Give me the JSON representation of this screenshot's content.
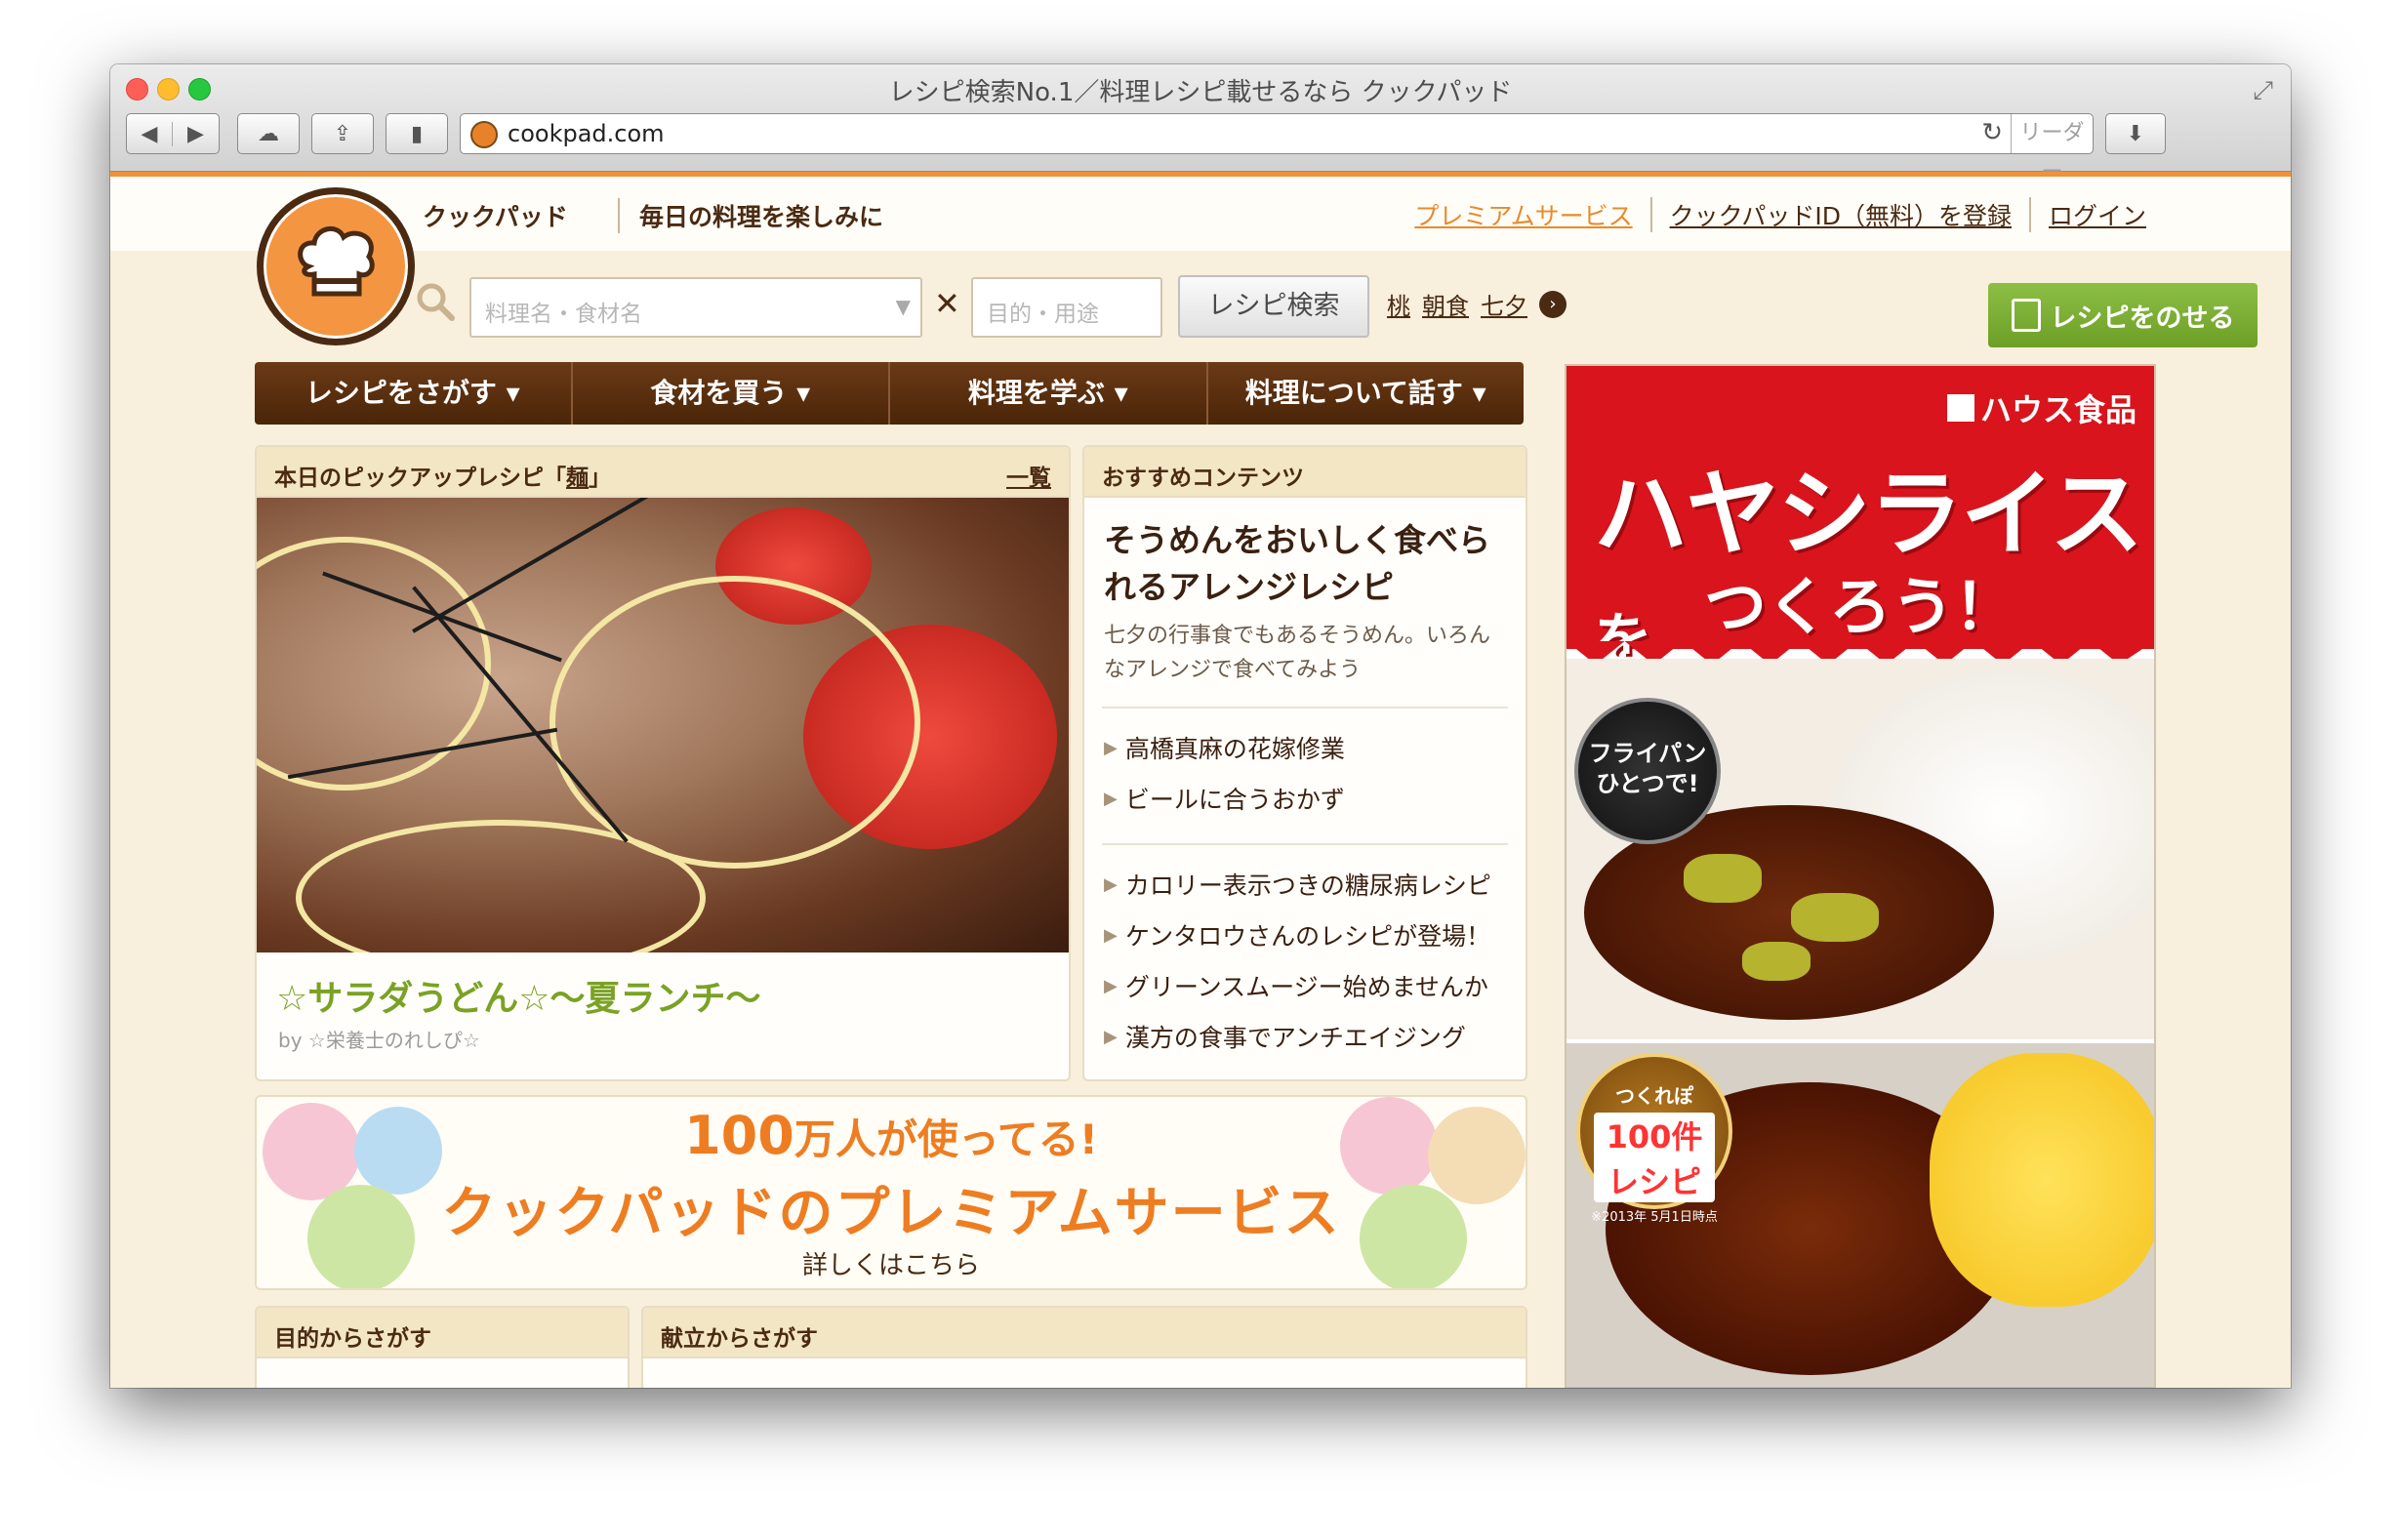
{
  "window": {
    "title": "レシピ検索No.1／料理レシピ載せるなら クックパッド",
    "url": "cookpad.com",
    "reader_label": "リーダー"
  },
  "header": {
    "site_name": "クックパッド",
    "tagline": "毎日の料理を楽しみに",
    "links": [
      "プレミアムサービス",
      "クックパッドID（無料）を登録",
      "ログイン"
    ],
    "search_placeholder": "料理名・食材名",
    "purpose_placeholder": "目的・用途",
    "search_button": "レシピ検索",
    "keywords": [
      "桃",
      "朝食",
      "七夕"
    ],
    "post_recipe": "レシピをのせる"
  },
  "nav": {
    "items": [
      "レシピをさがす ▾",
      "食材を買う ▾",
      "料理を学ぶ ▾",
      "料理について話す ▾"
    ]
  },
  "pickup": {
    "heading_prefix": "本日のピックアップレシピ「",
    "heading_keyword": "麺",
    "heading_suffix": "」",
    "list_link": "一覧",
    "recipe_title": "☆サラダうどん☆〜夏ランチ〜",
    "author": "by ☆栄養士のれしぴ☆"
  },
  "recommend": {
    "heading": "おすすめコンテンツ",
    "feature_title": "そうめんをおいしく食べられるアレンジレシピ",
    "feature_desc": "七夕の行事食でもあるそうめん。いろんなアレンジで食べてみよう",
    "links_a": [
      "高橋真麻の花嫁修業",
      "ビールに合うおかず"
    ],
    "links_b": [
      "カロリー表示つきの糖尿病レシピ",
      "ケンタロウさんのレシピが登場！",
      "グリーンスムージー始めませんか",
      "漢方の食事でアンチエイジング"
    ]
  },
  "premium_banner": {
    "number": "100",
    "users": "万人が使ってる!",
    "main": "クックパッドのプレミアムサービス",
    "detail": "詳しくはこちら"
  },
  "bottom": {
    "purpose_heading": "目的からさがす",
    "menu_heading": "献立からさがす"
  },
  "ad": {
    "brand": "ハウス食品",
    "headline": "ハヤシライス",
    "headline_particle": "を",
    "sub": "つくろう！",
    "pan_badge": "フライパン ひとつで!",
    "badge2_l1": "つくれぽ",
    "badge2_l2": "100件レシピ",
    "badge2_l3": "※2013年 5月1日時点"
  }
}
